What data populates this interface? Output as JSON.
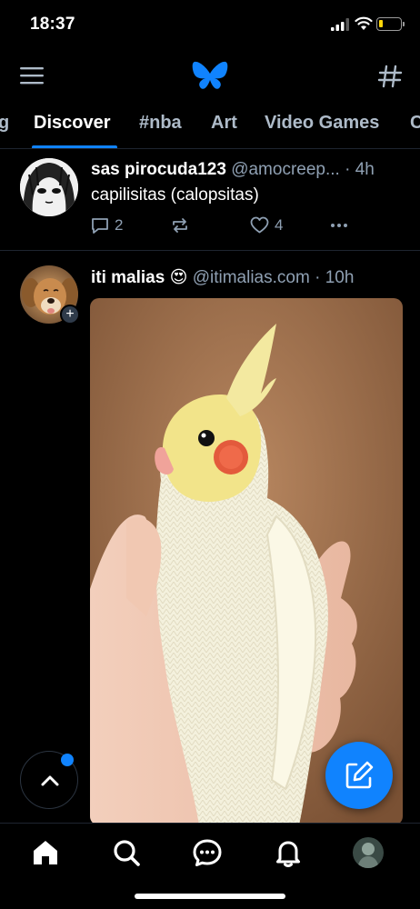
{
  "status_bar": {
    "time": "18:37"
  },
  "header": {
    "menu_icon": "hamburger-menu-icon",
    "logo_icon": "butterfly-logo-icon",
    "feeds_icon": "hashtag-icon"
  },
  "tabs": [
    {
      "label": "g",
      "active": false
    },
    {
      "label": "Discover",
      "active": true
    },
    {
      "label": "#nba",
      "active": false
    },
    {
      "label": "Art",
      "active": false
    },
    {
      "label": "Video Games",
      "active": false
    },
    {
      "label": "C",
      "active": false
    }
  ],
  "posts": [
    {
      "display_name": "sas pirocuda123",
      "handle": "@amocreep...",
      "separator": "·",
      "time": "4h",
      "text": "capilisitas (calopsitas)",
      "reply_count": "2",
      "repost_count": "",
      "like_count": "4"
    },
    {
      "display_name": "iti malias",
      "emoji": "😍",
      "handle": "@itimalias.com",
      "separator": "·",
      "time": "10h",
      "follow_badge": "+"
    }
  ],
  "bottom_nav": {
    "items": [
      "home-icon",
      "search-icon",
      "chat-icon",
      "bell-icon",
      "profile-avatar"
    ]
  },
  "colors": {
    "background": "#000000",
    "accent": "#1083fe",
    "muted_text": "#8fa0b3",
    "divider": "#1e2530"
  }
}
